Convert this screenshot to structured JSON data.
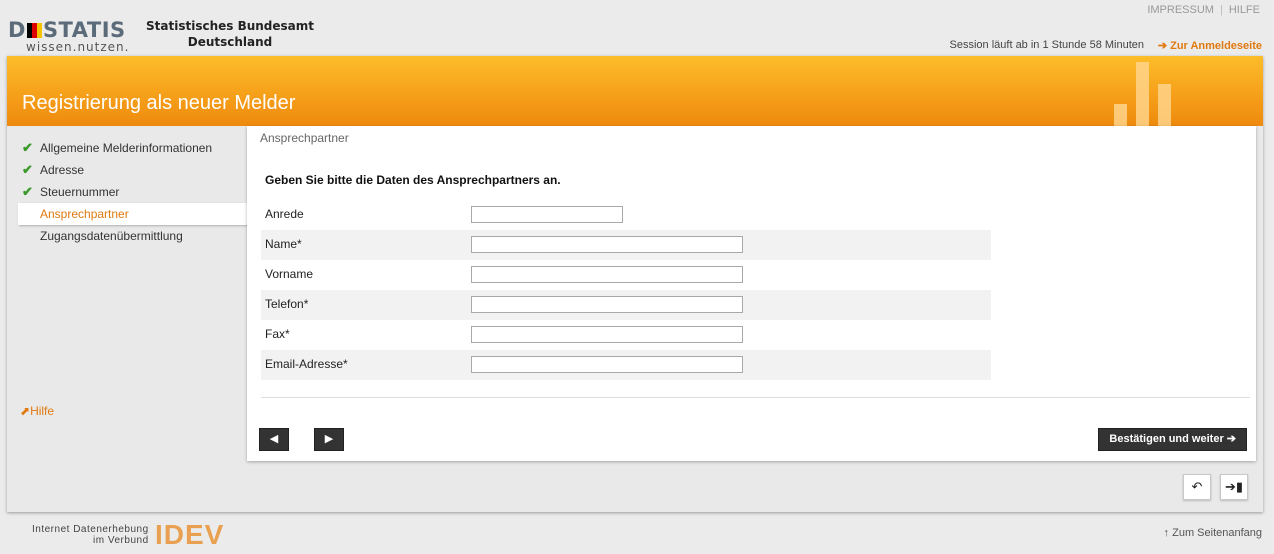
{
  "header": {
    "logo_word": "STATIS",
    "logo_tagline": "wissen.nutzen.",
    "org_line1": "Statistisches Bundesamt",
    "org_line2": "Deutschland",
    "impressum": "IMPRESSUM",
    "separator": "|",
    "hilfe": "HILFE",
    "session": "Session läuft ab in 1 Stunde 58 Minuten",
    "login_link": "Zur Anmeldeseite"
  },
  "banner": {
    "title": "Registrierung als neuer Melder"
  },
  "sidebar": {
    "items": [
      {
        "label": "Allgemeine Melderinformationen",
        "done": true
      },
      {
        "label": "Adresse",
        "done": true
      },
      {
        "label": "Steuernummer",
        "done": true
      },
      {
        "label": "Ansprechpartner",
        "active": true
      },
      {
        "label": "Zugangsdatenübermittlung"
      }
    ],
    "help": "Hilfe"
  },
  "panel": {
    "title": "Ansprechpartner",
    "intro": "Geben Sie bitte die Daten des Ansprechpartners an.",
    "fields": [
      {
        "label": "Anrede",
        "value": ""
      },
      {
        "label": "Name*",
        "value": ""
      },
      {
        "label": "Vorname",
        "value": ""
      },
      {
        "label": "Telefon*",
        "value": ""
      },
      {
        "label": "Fax*",
        "value": ""
      },
      {
        "label": "Email-Adresse*",
        "value": ""
      }
    ],
    "confirm": "Bestätigen und weiter"
  },
  "footer": {
    "line1": "Internet Datenerhebung",
    "line2": "im Verbund",
    "brand": "IDEV",
    "to_top": "Zum Seitenanfang"
  },
  "icons": {
    "check": "check-icon",
    "prev": "triangle-left-icon",
    "next": "triangle-right-icon",
    "undo": "undo-icon",
    "exit": "exit-icon"
  },
  "colors": {
    "accent": "#e07a10",
    "banner": "#f6a01a",
    "check": "#3a9a2a"
  }
}
